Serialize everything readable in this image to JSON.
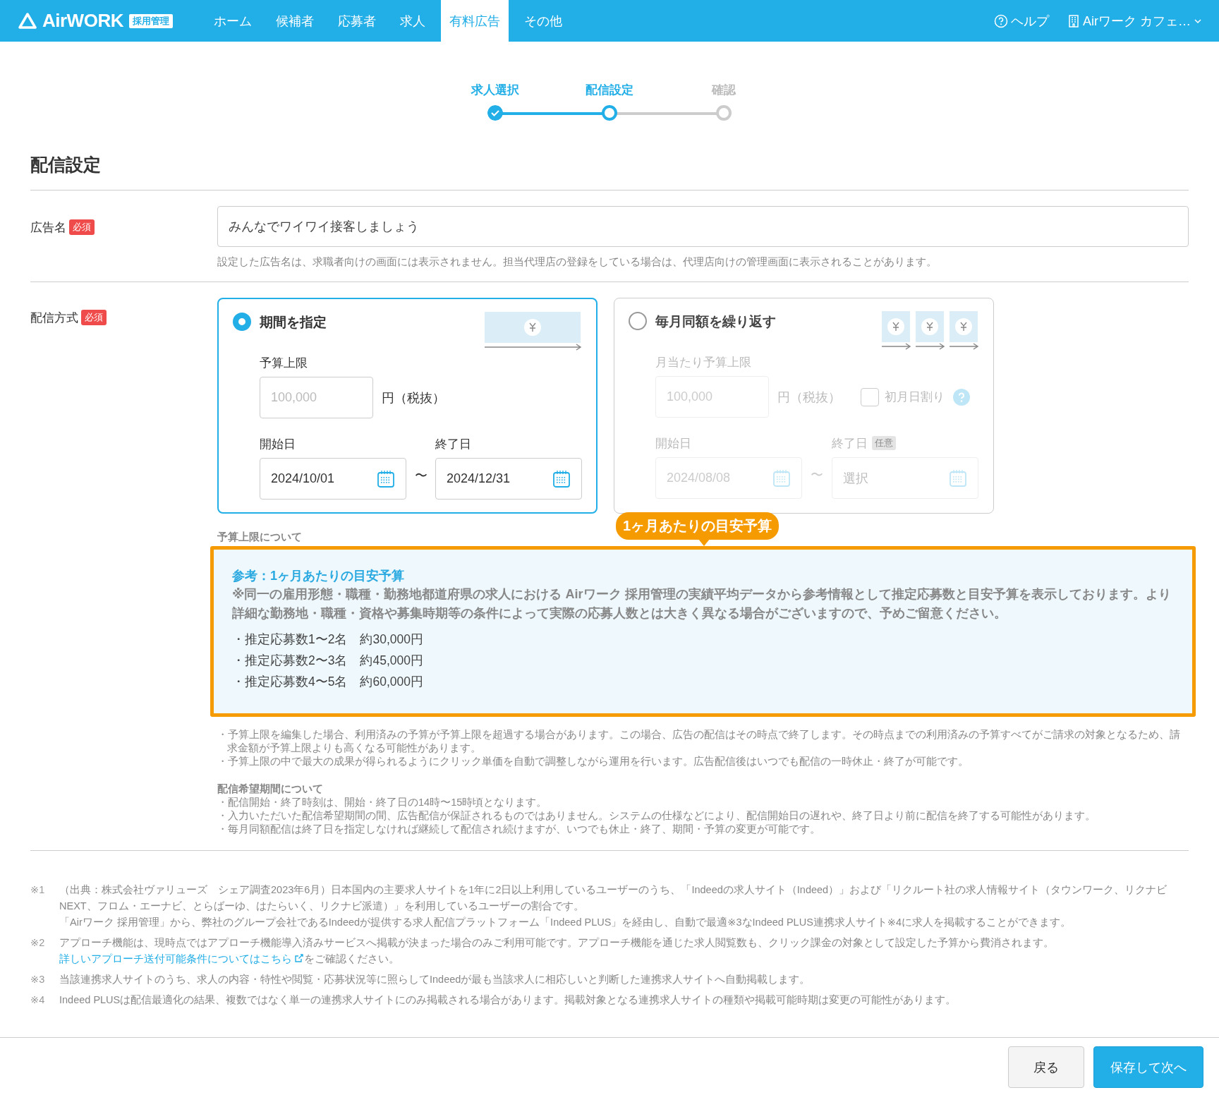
{
  "header": {
    "logo": "AirWORK",
    "logo_badge": "採用管理",
    "nav": [
      {
        "label": "ホーム",
        "selected": false
      },
      {
        "label": "候補者",
        "selected": false
      },
      {
        "label": "応募者",
        "selected": false
      },
      {
        "label": "求人",
        "selected": false
      },
      {
        "label": "有料広告",
        "selected": true
      },
      {
        "label": "その他",
        "selected": false
      }
    ],
    "help": "ヘルプ",
    "account": "Airワーク カフェ…"
  },
  "stepper": [
    {
      "label": "求人選択",
      "completed": true,
      "selected": false
    },
    {
      "label": "配信設定",
      "completed": false,
      "selected": true
    },
    {
      "label": "確認",
      "completed": false,
      "selected": false
    }
  ],
  "section_title": "配信設定",
  "ad_name": {
    "label": "広告名",
    "required_badge": "必須",
    "value": "みんなでワイワイ接客しましょう",
    "hint": "設定した広告名は、求職者向けの画面には表示されません。担当代理店の登録をしている場合は、代理店向けの管理画面に表示されることがあります。"
  },
  "delivery": {
    "label": "配信方式",
    "required_badge": "必須",
    "options": [
      {
        "kind": "period",
        "selected": true,
        "disabled": false,
        "title": "期間を指定",
        "budget_label": "予算上限",
        "budget_placeholder": "100,000",
        "unit": "円（税抜）",
        "start_label": "開始日",
        "start_value": "2024/10/01",
        "end_label": "終了日",
        "end_value": "2024/12/31",
        "separator": "〜"
      },
      {
        "kind": "monthly",
        "selected": false,
        "disabled": true,
        "title": "毎月同額を繰り返す",
        "budget_label": "月当たり予算上限",
        "budget_placeholder": "100,000",
        "unit": "円（税抜）",
        "prorate": {
          "label": "初月日割り",
          "checked": false
        },
        "start_label": "開始日",
        "start_value": "2024/08/08",
        "end_label": "終了日",
        "end_badge": "任意",
        "end_placeholder": "選択",
        "separator": "〜"
      }
    ]
  },
  "notes": {
    "budget_heading": "予算上限について",
    "budget_items": [
      "・予算上限を編集した場合、利用済みの予算が予算上限を超過する場合があります。この場合、広告の配信はその時点で終了します。その時点までの利用済みの予算すべてがご請求の対象となるため、請求金額が予算上限よりも高くなる可能性があります。",
      "・予算上限の中で最大の成果が得られるようにクリック単価を自動で調整しながら運用を行います。広告配信後はいつでも配信の一時休止・終了が可能です。"
    ],
    "period_heading": "配信希望期間について",
    "period_items": [
      "・配信開始・終了時刻は、開始・終了日の14時〜15時頃となります。",
      "・入力いただいた配信希望期間の間、広告配信が保証されるものではありません。システムの仕様などにより、配信開始日の遅れや、終了日より前に配信を終了する可能性があります。",
      "・毎月同額配信は終了日を指定しなければ継続して配信され続けますが、いつでも休止・終了、期間・予算の変更が可能です。"
    ]
  },
  "callout": {
    "badge": "1ヶ月あたりの目安予算",
    "title": "参考：1ヶ月あたりの目安予算",
    "description": "※同一の雇用形態・職種・勤務地都道府県の求人における Airワーク 採用管理の実績平均データから参考情報として推定応募数と目安予算を表示しております。より詳細な勤務地・職種・資格や募集時期等の条件によって実際の応募人数とは大きく異なる場合がございますので、予めご留意ください。",
    "estimates": [
      "・推定応募数1〜2名　約30,000円",
      "・推定応募数2〜3名　約45,000円",
      "・推定応募数4〜5名　約60,000円"
    ]
  },
  "footnotes": [
    {
      "mark": "※1",
      "paragraphs": [
        "（出典：株式会社ヴァリューズ　シェア調査2023年6月）日本国内の主要求人サイトを1年に2日以上利用しているユーザーのうち、「Indeedの求人サイト（Indeed）」および「リクルート社の求人情報サイト（タウンワーク、リクナビNEXT、フロム・エーナビ、とらばーゆ、はたらいく、リクナビ派遣）」を利用しているユーザーの割合です。",
        "「Airワーク 採用管理」から、弊社のグループ会社であるIndeedが提供する求人配信プラットフォーム「Indeed PLUS」を経由し、自動で最適※3なIndeed PLUS連携求人サイト※4に求人を掲載することができます。"
      ]
    },
    {
      "mark": "※2",
      "paragraphs": [
        "アプローチ機能は、現時点ではアプローチ機能導入済みサービスへ掲載が決まった場合のみご利用可能です。アプローチ機能を通じた求人閲覧数も、クリック課金の対象として設定した予算から費消されます。"
      ],
      "link": "詳しいアプローチ送付可能条件についてはこちら",
      "after_link": "をご確認ください。"
    },
    {
      "mark": "※3",
      "paragraphs": [
        "当該連携求人サイトのうち、求人の内容・特性や閲覧・応募状況等に照らしてIndeedが最も当該求人に相応しいと判断した連携求人サイトへ自動掲載します。"
      ]
    },
    {
      "mark": "※4",
      "paragraphs": [
        "Indeed PLUSは配信最適化の結果、複数ではなく単一の連携求人サイトにのみ掲載される場合があります。掲載対象となる連携求人サイトの種類や掲載可能時期は変更の可能性があります。"
      ]
    }
  ],
  "buttons": {
    "back": "戻る",
    "next": "保存して次へ"
  }
}
